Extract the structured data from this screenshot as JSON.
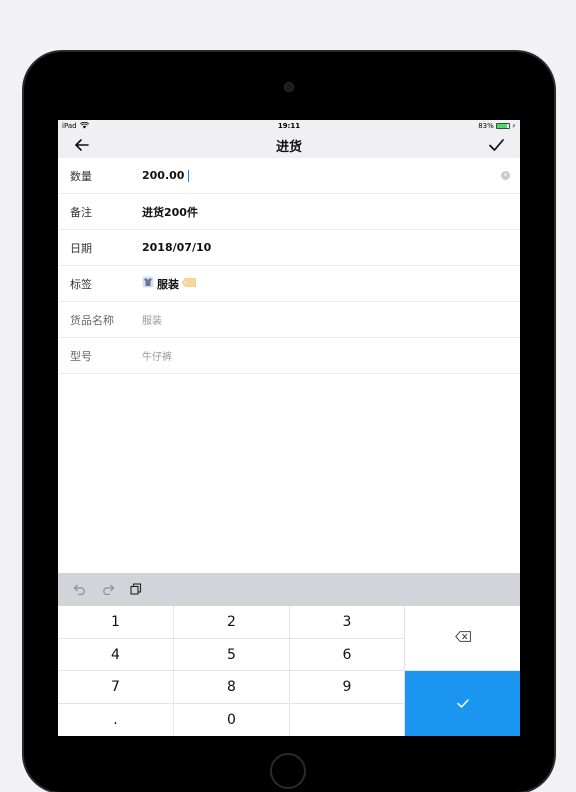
{
  "status_bar": {
    "device": "iPad",
    "time": "19:11",
    "battery": "83%",
    "battery_level": 0.83
  },
  "nav": {
    "title": "进货"
  },
  "form": {
    "rows": [
      {
        "label": "数量",
        "value": "200.00"
      },
      {
        "label": "备注",
        "value": "进货200件"
      },
      {
        "label": "日期",
        "value": "2018/07/10"
      },
      {
        "label": "标签",
        "value": "服装"
      },
      {
        "label": "货品名称",
        "value": "服装"
      },
      {
        "label": "型号",
        "value": "牛仔裤"
      }
    ]
  },
  "keypad": {
    "keys": [
      "1",
      "2",
      "3",
      "4",
      "5",
      "6",
      "7",
      "8",
      "9",
      ".",
      "0"
    ]
  },
  "colors": {
    "accent": "#1a96f0",
    "toolbar": "#d1d4d9",
    "nav_bg": "#efeff4"
  }
}
